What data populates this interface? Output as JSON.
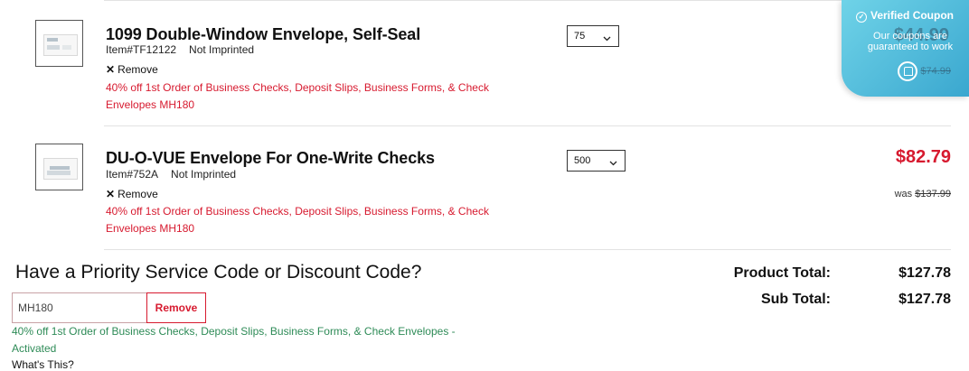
{
  "items": [
    {
      "title": "1099 Double-Window Envelope, Self-Seal",
      "item_number": "Item#TF12122",
      "imprint": "Not Imprinted",
      "remove_label": "Remove",
      "promo_line1": "40% off 1st Order of Business Checks, Deposit Slips, Business Forms, & Check",
      "promo_line2": "Envelopes  MH180",
      "quantity": "75"
    },
    {
      "title": "DU-O-VUE Envelope For One-Write Checks",
      "item_number": "Item#752A",
      "imprint": "Not Imprinted",
      "remove_label": "Remove",
      "promo_line1": "40% off 1st Order of Business Checks, Deposit Slips, Business Forms, & Check",
      "promo_line2": "Envelopes  MH180",
      "quantity": "500",
      "price": "$82.79",
      "was_label": "was",
      "was_price": "$137.99"
    }
  ],
  "discount": {
    "heading": "Have a Priority Service Code or Discount Code?",
    "code_value": "MH180",
    "remove_label": "Remove",
    "status_line1": "40% off 1st Order of Business Checks, Deposit Slips, Business Forms, & Check Envelopes -",
    "status_line2": "Activated",
    "whats_this": "What's This?"
  },
  "totals": {
    "product_total_label": "Product Total:",
    "product_total": "$127.78",
    "sub_total_label": "Sub Total:",
    "sub_total": "$127.78"
  },
  "coupon_badge": {
    "title": "Verified Coupon",
    "line1": "Our coupons are",
    "line2": "guaranteed to work",
    "hidden_price": "$44.99",
    "hidden_was": "$74.99"
  },
  "colors": {
    "accent_red": "#d71a2f",
    "success_green": "#2e8b57",
    "coupon_blue": "#3aa7cf"
  },
  "icons": [
    "close-x-icon",
    "chevron-down-icon",
    "check-circle-icon",
    "coupon-widget-icon"
  ]
}
